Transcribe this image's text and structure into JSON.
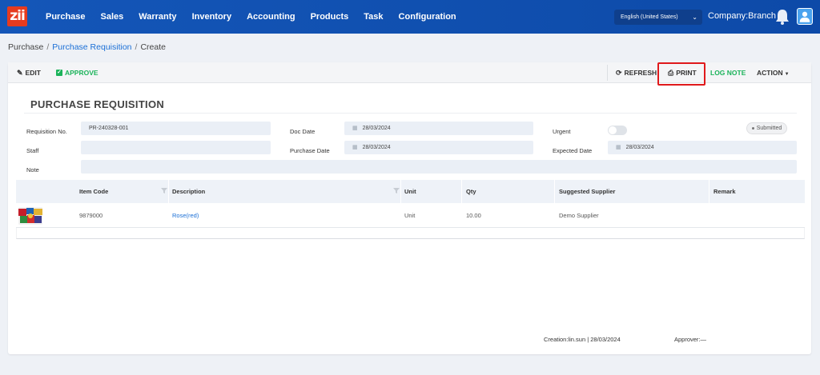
{
  "topbar": {
    "logo_text": "zii",
    "nav": [
      "Purchase",
      "Sales",
      "Warranty",
      "Inventory",
      "Accounting",
      "Products",
      "Task",
      "Configuration"
    ],
    "language": "English (United States)",
    "company": "Company:Branch 2"
  },
  "breadcrumb": {
    "root": "Purchase",
    "section": "Purchase Requisition",
    "current": "Create"
  },
  "toolbar": {
    "edit": "EDIT",
    "approve": "APPROVE",
    "refresh": "REFRESH",
    "print": "PRINT",
    "log_note": "LOG NOTE",
    "action": "ACTION"
  },
  "form": {
    "title": "PURCHASE REQUISITION",
    "requisition_no_label": "Requisition No.",
    "requisition_no": "PR-240328-001",
    "staff_label": "Staff",
    "staff": "",
    "note_label": "Note",
    "note": "",
    "doc_date_label": "Doc Date",
    "doc_date": "28/03/2024",
    "purchase_date_label": "Purchase Date",
    "purchase_date": "28/03/2024",
    "urgent_label": "Urgent",
    "urgent": false,
    "expected_date_label": "Expected Date",
    "expected_date": "28/03/2024",
    "status": "Submitted"
  },
  "table": {
    "columns": [
      "Item Code",
      "Description",
      "Unit",
      "Qty",
      "Suggested Supplier",
      "Remark"
    ],
    "rows": [
      {
        "item_code": "9879000",
        "description": "Rose(red)",
        "unit": "Unit",
        "qty": "10.00",
        "supplier": "Demo Supplier",
        "remark": ""
      }
    ]
  },
  "footer": {
    "creation": "Creation:lin.sun | 28/03/2024",
    "approver": "Approver:—"
  },
  "colors": {
    "nav_bg": "#1456b8",
    "accent": "#1a6fd6",
    "approve_green": "#1bb35a",
    "highlight_red": "#e0191b"
  }
}
